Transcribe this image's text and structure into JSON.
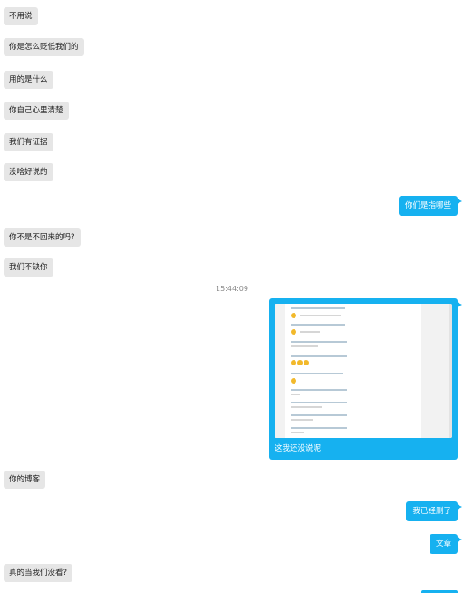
{
  "messages": [
    {
      "side": "in",
      "text": "不用说"
    },
    {
      "side": "in",
      "text": "你是怎么贬低我们的"
    },
    {
      "side": "in",
      "text": "用的是什么"
    },
    {
      "side": "in",
      "text": "你自己心里清楚"
    },
    {
      "side": "in",
      "text": "我们有证据"
    },
    {
      "side": "in",
      "text": "没啥好说的"
    },
    {
      "side": "out",
      "text": "你们是指哪些"
    },
    {
      "side": "in",
      "text": "你不是不回来的吗?"
    },
    {
      "side": "in",
      "text": "我们不缺你"
    },
    {
      "side": "time",
      "text": "15:44:09"
    },
    {
      "side": "out-image",
      "caption": "这我还没说呢",
      "image": "chat-screenshot-thumbnail"
    },
    {
      "side": "in",
      "text": "你的博客"
    },
    {
      "side": "out",
      "text": "我已经删了"
    },
    {
      "side": "out",
      "text": "文章"
    },
    {
      "side": "in",
      "text": "真的当我们没看?"
    }
  ],
  "colors": {
    "incoming_bubble": "#e6e6e6",
    "outgoing_bubble": "#16b1f0",
    "background": "#ffffff"
  }
}
